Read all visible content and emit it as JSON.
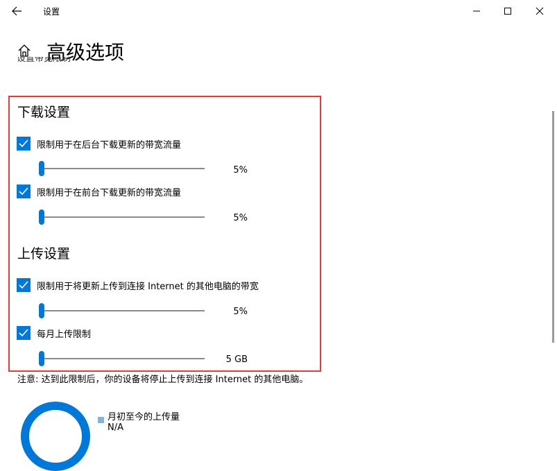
{
  "window": {
    "app_title": "设置",
    "back_icon": "back-arrow-icon",
    "controls": [
      "minimize-icon",
      "maximize-icon",
      "close-icon"
    ]
  },
  "header": {
    "title": "高级选项",
    "home_icon": "home-icon",
    "cut_text": "设置带宽限制"
  },
  "download": {
    "title": "下载设置",
    "background": {
      "label": "限制用于在后台下载更新的带宽流量",
      "checked": true,
      "value_text": "5%",
      "value_percent": 5
    },
    "foreground": {
      "label": "限制用于在前台下载更新的带宽流量",
      "checked": true,
      "value_text": "5%",
      "value_percent": 5
    }
  },
  "upload": {
    "title": "上传设置",
    "bandwidth": {
      "label": "限制用于将更新上传到连接 Internet 的其他电脑的带宽",
      "checked": true,
      "value_text": "5%",
      "value_percent": 5
    },
    "monthly": {
      "label": "每月上传限制",
      "checked": true,
      "value_text": "5 GB",
      "value_gb": 5
    }
  },
  "note": "注意: 达到此限制后，你的设备将停止上传到连接 Internet 的其他电脑。",
  "usage": {
    "legend_label": "月初至今的上传量",
    "legend_value": "N/A"
  },
  "colors": {
    "accent": "#0078d7",
    "highlight_border": "#e03a3e",
    "legend": "#79b7e9"
  }
}
